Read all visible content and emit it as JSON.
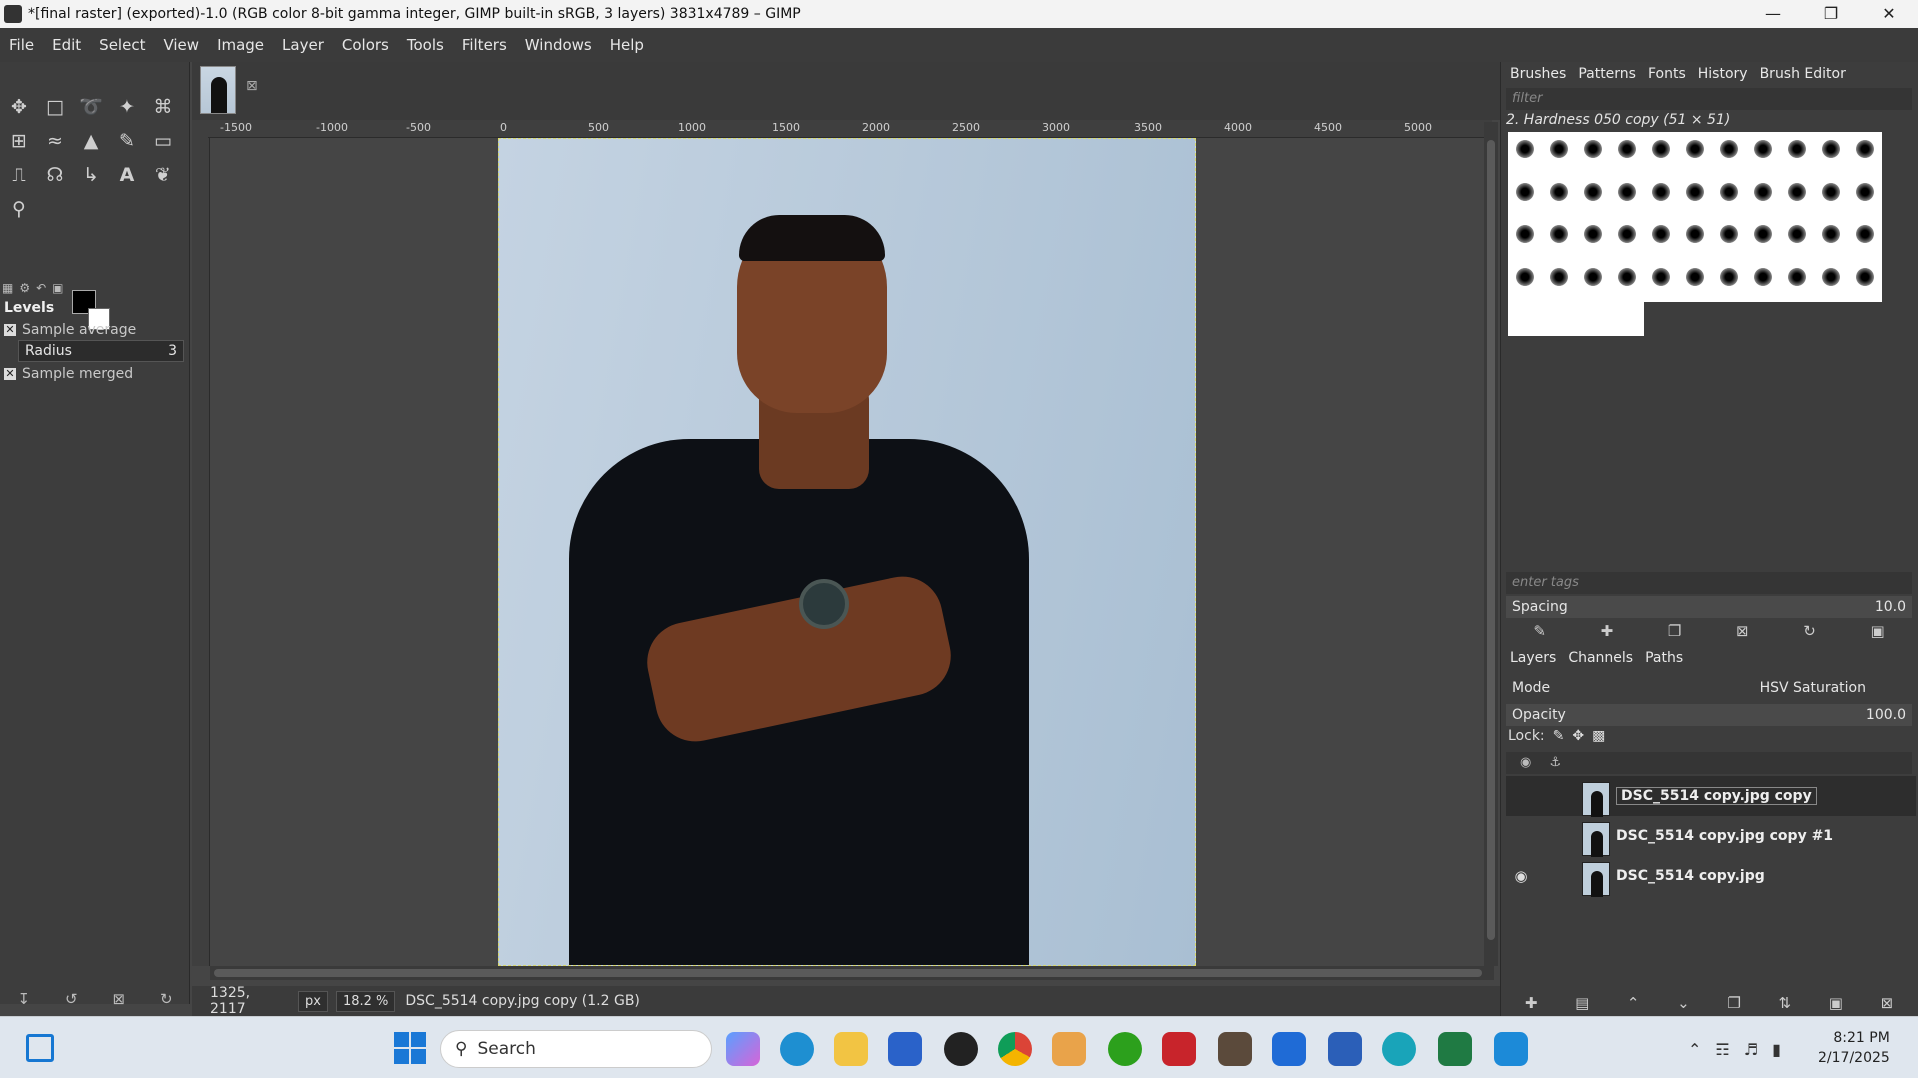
{
  "window": {
    "title": "*[final raster] (exported)-1.0 (RGB color 8-bit gamma integer, GIMP built-in sRGB, 3 layers) 3831x4789 – GIMP"
  },
  "menu": [
    "File",
    "Edit",
    "Select",
    "View",
    "Image",
    "Layer",
    "Colors",
    "Tools",
    "Filters",
    "Windows",
    "Help"
  ],
  "tool_options": {
    "title": "Levels",
    "sample_average": "Sample average",
    "radius_label": "Radius",
    "radius_value": "3",
    "sample_merged": "Sample merged"
  },
  "ruler": [
    "-1500",
    "-1000",
    "-500",
    "0",
    "500",
    "1000",
    "1500",
    "2000",
    "2500",
    "3000",
    "3500",
    "4000",
    "4500",
    "5000"
  ],
  "status": {
    "coords": "1325, 2117",
    "unit": "px",
    "zoom": "18.2 %",
    "layer_info": "DSC_5514 copy.jpg copy (1.2 GB)"
  },
  "brushes_dock": {
    "tabs": [
      "Brushes",
      "Patterns",
      "Fonts",
      "History",
      "Brush Editor"
    ],
    "filter_placeholder": "filter",
    "current_brush": "2. Hardness 050 copy (51 × 51)",
    "tags_placeholder": "enter tags",
    "spacing_label": "Spacing",
    "spacing_value": "10.0"
  },
  "layers_dock": {
    "tabs": [
      "Layers",
      "Channels",
      "Paths"
    ],
    "mode_label": "Mode",
    "mode_value": "HSV Saturation",
    "opacity_label": "Opacity",
    "opacity_value": "100.0",
    "lock_label": "Lock:",
    "layers": [
      {
        "name": "DSC_5514 copy.jpg copy",
        "visible": false,
        "active": true
      },
      {
        "name": "DSC_5514 copy.jpg copy #1",
        "visible": false,
        "active": false
      },
      {
        "name": "DSC_5514 copy.jpg",
        "visible": true,
        "active": false
      }
    ]
  },
  "taskbar": {
    "search_placeholder": "Search",
    "time": "8:21 PM",
    "date": "2/17/2025"
  }
}
